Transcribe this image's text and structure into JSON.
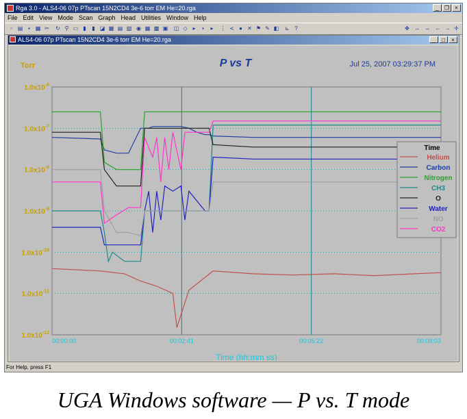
{
  "app": {
    "title": "Rga 3.0 - ALS4-06 07p PTscan 15N2CD4 3e-6 torr EM He=20.rga",
    "window_buttons": [
      "_",
      "❐",
      "×"
    ]
  },
  "menu": [
    "File",
    "Edit",
    "View",
    "Mode",
    "Scan",
    "Graph",
    "Head",
    "Utilities",
    "Window",
    "Help"
  ],
  "child_window": {
    "title": "ALS4-06 07p PTscan 15N2CD4 3e-6 torr EM He=20.rga",
    "buttons": [
      "_",
      "□",
      "×"
    ]
  },
  "status_bar": "For Help, press F1",
  "caption": "UGA Windows software — P vs. T mode",
  "chart_data": {
    "type": "line",
    "title": "P vs T",
    "unit_label": "Torr",
    "timestamp": "Jul 25, 2007   03:29:37 PM",
    "xlabel": "Time (hh:mm ss)",
    "x_ticks": [
      "00:00:00",
      "00:02:41",
      "00:05:22",
      "00:08:03"
    ],
    "xlim_seconds": [
      0,
      483
    ],
    "y_scale": "log",
    "ylim": [
      1e-12,
      1e-06
    ],
    "y_ticks": [
      "1.0x10-6",
      "1.0x10-7",
      "1.0x10-8",
      "1.0x10-9",
      "1.0x10-10",
      "1.0x10-11",
      "1.0x10-12"
    ],
    "y_tick_mantissa": "1.0x10",
    "y_tick_exponents": [
      "-6",
      "-7",
      "-8",
      "-9",
      "-10",
      "-11",
      "-12"
    ],
    "grid": true,
    "legend_title": "Time",
    "legend_position": "right",
    "series": [
      {
        "name": "Helium",
        "color": "#c0504d",
        "x": [
          0,
          60,
          90,
          110,
          130,
          150,
          155,
          170,
          200,
          250,
          300,
          350,
          400,
          450,
          483
        ],
        "y": [
          4e-11,
          3.5e-11,
          3e-11,
          2e-11,
          1.5e-11,
          1e-11,
          1.5e-12,
          1.2e-11,
          3.5e-11,
          3e-11,
          2.8e-11,
          3e-11,
          2.7e-11,
          3e-11,
          3.2e-11
        ]
      },
      {
        "name": "Carbon",
        "color": "#1f3f9f",
        "x": [
          0,
          60,
          65,
          80,
          95,
          110,
          120,
          125,
          130,
          140,
          150,
          160,
          170,
          180,
          190,
          195,
          200,
          250,
          300,
          380,
          483
        ],
        "y": [
          6e-08,
          5.5e-08,
          3e-08,
          2.5e-08,
          2.5e-08,
          1e-07,
          1e-07,
          1.1e-07,
          1.1e-07,
          1.1e-07,
          1.1e-07,
          1.1e-07,
          1e-07,
          8e-08,
          7e-08,
          7e-08,
          6.5e-08,
          6e-08,
          6e-08,
          6e-08,
          6e-08
        ]
      },
      {
        "name": "Nitrogen",
        "color": "#2ca02c",
        "x": [
          0,
          60,
          65,
          80,
          95,
          110,
          115,
          190,
          195,
          200,
          250,
          300,
          483
        ],
        "y": [
          2.5e-07,
          2.5e-07,
          1.5e-08,
          1e-08,
          1e-08,
          1e-08,
          2.5e-07,
          2.5e-07,
          2.5e-07,
          2.5e-07,
          2.5e-07,
          2.5e-07,
          2.5e-07
        ]
      },
      {
        "name": "CH3",
        "color": "#1b8a8a",
        "x": [
          0,
          60,
          65,
          70,
          75,
          90,
          110,
          115,
          120,
          130,
          140,
          150,
          160,
          170,
          180,
          190,
          195,
          200,
          250,
          300,
          483
        ],
        "y": [
          1e-09,
          1e-09,
          3e-10,
          6e-11,
          1e-10,
          6e-11,
          6e-11,
          1e-09,
          1e-09,
          1e-09,
          1e-09,
          1e-09,
          1e-09,
          1e-09,
          1e-09,
          1e-09,
          1e-09,
          1.2e-07,
          1.2e-07,
          1.2e-07,
          1.2e-07
        ]
      },
      {
        "name": "O",
        "color": "#202020",
        "x": [
          0,
          60,
          65,
          80,
          95,
          110,
          115,
          190,
          195,
          200,
          250,
          300,
          483
        ],
        "y": [
          8e-08,
          8e-08,
          1e-08,
          4e-09,
          4e-09,
          4e-09,
          1e-07,
          1e-07,
          1e-07,
          4e-08,
          3.5e-08,
          3.5e-08,
          3.5e-08
        ]
      },
      {
        "name": "Water",
        "color": "#2020c0",
        "x": [
          0,
          60,
          65,
          80,
          95,
          110,
          115,
          120,
          125,
          130,
          135,
          140,
          150,
          160,
          165,
          170,
          190,
          195,
          200,
          250,
          300,
          483
        ],
        "y": [
          4e-10,
          4e-10,
          1.5e-10,
          1.5e-10,
          1.5e-10,
          1.5e-10,
          1e-09,
          3e-09,
          3e-10,
          3e-09,
          6e-10,
          4e-09,
          3e-09,
          4e-09,
          6e-10,
          3e-09,
          1e-09,
          1e-09,
          2e-08,
          1.8e-08,
          1.8e-08,
          1.8e-08
        ]
      },
      {
        "name": "NO",
        "color": "#a0a0a0",
        "x": [
          0,
          60,
          65,
          80,
          95,
          110,
          115,
          190,
          195,
          200,
          250,
          300,
          483
        ],
        "y": [
          1e-08,
          1e-08,
          1e-09,
          3e-10,
          3e-10,
          2.5e-10,
          1e-09,
          1e-09,
          1e-09,
          5e-09,
          5e-09,
          5e-09,
          5e-09
        ]
      },
      {
        "name": "CO2",
        "color": "#ff33cc",
        "x": [
          0,
          60,
          65,
          80,
          95,
          110,
          115,
          125,
          130,
          135,
          140,
          145,
          150,
          160,
          165,
          170,
          190,
          195,
          200,
          483
        ],
        "y": [
          5e-09,
          5e-09,
          5e-10,
          8e-10,
          1.2e-09,
          1.2e-09,
          6e-08,
          2e-08,
          6e-08,
          5e-09,
          6e-08,
          1e-08,
          8e-08,
          1e-08,
          8e-08,
          8e-08,
          8e-08,
          8e-08,
          1.5e-07,
          1.5e-07
        ]
      }
    ]
  }
}
